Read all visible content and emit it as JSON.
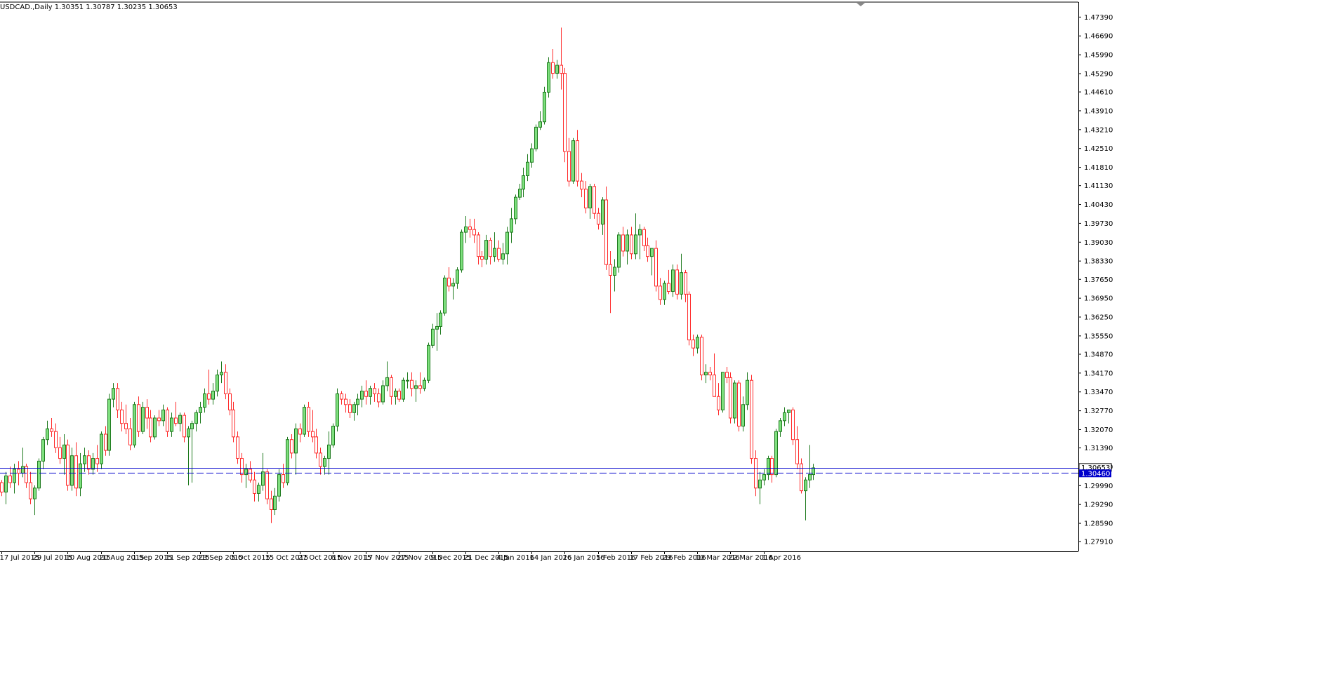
{
  "title": "USDCAD.,Daily  1.30351 1.30787 1.30235 1.30653",
  "colors": {
    "bull_body": "#7ee07e",
    "bull_border": "#1e7a1e",
    "bear_body": "#ffffff",
    "bear_border": "#ff2a2a",
    "bid_line": "#0000cc",
    "ask_line": "#0000cc",
    "frame": "#000000",
    "bid_tag_bg": "#0000cc",
    "bid_tag_text": "#ffffff",
    "last_tag_bg": "#ffffff",
    "last_tag_text": "#000000"
  },
  "price_tags": {
    "last": "1.30653",
    "bid": "1.30460"
  },
  "chart_data": {
    "type": "candlestick",
    "symbol": "USDCAD.",
    "timeframe": "Daily",
    "ylim": [
      1.2755,
      1.4792
    ],
    "y_ticks": [
      "1.47390",
      "1.46690",
      "1.45990",
      "1.45290",
      "1.44610",
      "1.43910",
      "1.43210",
      "1.42510",
      "1.41810",
      "1.41130",
      "1.40430",
      "1.39730",
      "1.39030",
      "1.38330",
      "1.37650",
      "1.36950",
      "1.36250",
      "1.35550",
      "1.34870",
      "1.34170",
      "1.33470",
      "1.32770",
      "1.32070",
      "1.31390",
      "1.30690",
      "1.29990",
      "1.29290",
      "1.28590",
      "1.27910"
    ],
    "x_ticks": [
      {
        "label": "17 Jul 2015",
        "index": 0
      },
      {
        "label": "29 Jul 2015",
        "index": 8
      },
      {
        "label": "10 Aug 2015",
        "index": 16
      },
      {
        "label": "20 Aug 2015",
        "index": 24
      },
      {
        "label": "1 Sep 2015",
        "index": 32
      },
      {
        "label": "11 Sep 2015",
        "index": 40
      },
      {
        "label": "23 Sep 2015",
        "index": 48
      },
      {
        "label": "5 Oct 2015",
        "index": 56
      },
      {
        "label": "15 Oct 2015",
        "index": 64
      },
      {
        "label": "27 Oct 2015",
        "index": 72
      },
      {
        "label": "6 Nov 2015",
        "index": 80
      },
      {
        "label": "17 Nov 2015",
        "index": 88
      },
      {
        "label": "27 Nov 2015",
        "index": 96
      },
      {
        "label": "9 Dec 2015",
        "index": 104
      },
      {
        "label": "21 Dec 2015",
        "index": 112
      },
      {
        "label": "4 Jan 2016",
        "index": 120
      },
      {
        "label": "14 Jan 2016",
        "index": 128
      },
      {
        "label": "26 Jan 2016",
        "index": 136
      },
      {
        "label": "5 Feb 2016",
        "index": 144
      },
      {
        "label": "17 Feb 2016",
        "index": 152
      },
      {
        "label": "29 Feb 2016",
        "index": 160
      },
      {
        "label": "10 Mar 2016",
        "index": 168
      },
      {
        "label": "22 Mar 2016",
        "index": 176
      },
      {
        "label": "1 Apr 2016",
        "index": 184
      }
    ],
    "horizontal_lines": [
      {
        "name": "ask-line",
        "value": 1.30653,
        "style": "solid"
      },
      {
        "name": "bid-line",
        "value": 1.3046,
        "style": "dashed"
      }
    ],
    "candles": [
      [
        1.301,
        1.302,
        1.296,
        1.2975
      ],
      [
        1.2975,
        1.305,
        1.293,
        1.3035
      ],
      [
        1.3035,
        1.307,
        1.299,
        1.301
      ],
      [
        1.301,
        1.308,
        1.297,
        1.306
      ],
      [
        1.306,
        1.309,
        1.3,
        1.3045
      ],
      [
        1.3045,
        1.314,
        1.303,
        1.307
      ],
      [
        1.307,
        1.308,
        1.299,
        1.301
      ],
      [
        1.301,
        1.305,
        1.293,
        1.295
      ],
      [
        1.295,
        1.3,
        1.289,
        1.299
      ],
      [
        1.299,
        1.31,
        1.298,
        1.309
      ],
      [
        1.309,
        1.318,
        1.306,
        1.317
      ],
      [
        1.317,
        1.324,
        1.315,
        1.321
      ],
      [
        1.321,
        1.325,
        1.318,
        1.32
      ],
      [
        1.32,
        1.323,
        1.312,
        1.314
      ],
      [
        1.314,
        1.318,
        1.308,
        1.31
      ],
      [
        1.31,
        1.319,
        1.304,
        1.315
      ],
      [
        1.315,
        1.317,
        1.298,
        1.3
      ],
      [
        1.3,
        1.314,
        1.298,
        1.311
      ],
      [
        1.311,
        1.316,
        1.296,
        1.299
      ],
      [
        1.299,
        1.312,
        1.296,
        1.308
      ],
      [
        1.308,
        1.314,
        1.305,
        1.311
      ],
      [
        1.311,
        1.313,
        1.304,
        1.306
      ],
      [
        1.306,
        1.312,
        1.304,
        1.31
      ],
      [
        1.31,
        1.315,
        1.305,
        1.308
      ],
      [
        1.308,
        1.32,
        1.306,
        1.319
      ],
      [
        1.319,
        1.322,
        1.311,
        1.313
      ],
      [
        1.313,
        1.334,
        1.311,
        1.332
      ],
      [
        1.332,
        1.338,
        1.329,
        1.336
      ],
      [
        1.336,
        1.338,
        1.325,
        1.328
      ],
      [
        1.328,
        1.331,
        1.32,
        1.323
      ],
      [
        1.323,
        1.33,
        1.319,
        1.321
      ],
      [
        1.321,
        1.325,
        1.313,
        1.315
      ],
      [
        1.315,
        1.331,
        1.314,
        1.33
      ],
      [
        1.33,
        1.333,
        1.318,
        1.32
      ],
      [
        1.32,
        1.331,
        1.319,
        1.329
      ],
      [
        1.329,
        1.332,
        1.321,
        1.325
      ],
      [
        1.325,
        1.328,
        1.316,
        1.318
      ],
      [
        1.318,
        1.326,
        1.317,
        1.325
      ],
      [
        1.325,
        1.328,
        1.322,
        1.324
      ],
      [
        1.324,
        1.33,
        1.322,
        1.328
      ],
      [
        1.328,
        1.329,
        1.318,
        1.32
      ],
      [
        1.32,
        1.327,
        1.318,
        1.325
      ],
      [
        1.325,
        1.331,
        1.322,
        1.323
      ],
      [
        1.323,
        1.327,
        1.32,
        1.326
      ],
      [
        1.326,
        1.327,
        1.316,
        1.318
      ],
      [
        1.318,
        1.322,
        1.3,
        1.321
      ],
      [
        1.321,
        1.324,
        1.301,
        1.323
      ],
      [
        1.323,
        1.328,
        1.32,
        1.327
      ],
      [
        1.327,
        1.331,
        1.323,
        1.329
      ],
      [
        1.329,
        1.336,
        1.327,
        1.334
      ],
      [
        1.334,
        1.343,
        1.33,
        1.332
      ],
      [
        1.332,
        1.338,
        1.33,
        1.335
      ],
      [
        1.335,
        1.343,
        1.333,
        1.341
      ],
      [
        1.341,
        1.346,
        1.338,
        1.342
      ],
      [
        1.342,
        1.345,
        1.332,
        1.334
      ],
      [
        1.334,
        1.336,
        1.326,
        1.328
      ],
      [
        1.328,
        1.331,
        1.316,
        1.318
      ],
      [
        1.318,
        1.32,
        1.308,
        1.31
      ],
      [
        1.31,
        1.312,
        1.301,
        1.304
      ],
      [
        1.304,
        1.308,
        1.299,
        1.306
      ],
      [
        1.306,
        1.309,
        1.301,
        1.302
      ],
      [
        1.302,
        1.305,
        1.294,
        1.297
      ],
      [
        1.297,
        1.301,
        1.294,
        1.3
      ],
      [
        1.3,
        1.312,
        1.298,
        1.305
      ],
      [
        1.305,
        1.306,
        1.293,
        1.295
      ],
      [
        1.295,
        1.298,
        1.286,
        1.291
      ],
      [
        1.291,
        1.299,
        1.289,
        1.296
      ],
      [
        1.296,
        1.306,
        1.294,
        1.304
      ],
      [
        1.304,
        1.308,
        1.299,
        1.301
      ],
      [
        1.301,
        1.318,
        1.3,
        1.317
      ],
      [
        1.317,
        1.319,
        1.31,
        1.312
      ],
      [
        1.312,
        1.323,
        1.304,
        1.321
      ],
      [
        1.321,
        1.323,
        1.316,
        1.319
      ],
      [
        1.319,
        1.33,
        1.318,
        1.329
      ],
      [
        1.329,
        1.331,
        1.318,
        1.32
      ],
      [
        1.32,
        1.328,
        1.316,
        1.318
      ],
      [
        1.318,
        1.321,
        1.31,
        1.312
      ],
      [
        1.312,
        1.314,
        1.304,
        1.307
      ],
      [
        1.307,
        1.311,
        1.304,
        1.31
      ],
      [
        1.31,
        1.32,
        1.304,
        1.315
      ],
      [
        1.315,
        1.323,
        1.314,
        1.322
      ],
      [
        1.322,
        1.336,
        1.32,
        1.334
      ],
      [
        1.334,
        1.335,
        1.33,
        1.332
      ],
      [
        1.332,
        1.334,
        1.327,
        1.33
      ],
      [
        1.33,
        1.332,
        1.325,
        1.327
      ],
      [
        1.327,
        1.331,
        1.324,
        1.33
      ],
      [
        1.33,
        1.334,
        1.326,
        1.332
      ],
      [
        1.332,
        1.337,
        1.329,
        1.335
      ],
      [
        1.335,
        1.339,
        1.33,
        1.333
      ],
      [
        1.333,
        1.337,
        1.33,
        1.336
      ],
      [
        1.336,
        1.338,
        1.331,
        1.334
      ],
      [
        1.334,
        1.336,
        1.329,
        1.331
      ],
      [
        1.331,
        1.339,
        1.33,
        1.337
      ],
      [
        1.337,
        1.346,
        1.335,
        1.34
      ],
      [
        1.34,
        1.341,
        1.33,
        1.333
      ],
      [
        1.333,
        1.336,
        1.33,
        1.335
      ],
      [
        1.335,
        1.336,
        1.331,
        1.332
      ],
      [
        1.332,
        1.34,
        1.331,
        1.339
      ],
      [
        1.339,
        1.342,
        1.336,
        1.339
      ],
      [
        1.339,
        1.342,
        1.333,
        1.336
      ],
      [
        1.336,
        1.339,
        1.331,
        1.337
      ],
      [
        1.337,
        1.342,
        1.334,
        1.336
      ],
      [
        1.336,
        1.34,
        1.335,
        1.339
      ],
      [
        1.339,
        1.353,
        1.338,
        1.352
      ],
      [
        1.352,
        1.36,
        1.351,
        1.358
      ],
      [
        1.358,
        1.364,
        1.35,
        1.359
      ],
      [
        1.359,
        1.365,
        1.356,
        1.364
      ],
      [
        1.364,
        1.378,
        1.363,
        1.377
      ],
      [
        1.377,
        1.381,
        1.372,
        1.374
      ],
      [
        1.374,
        1.377,
        1.369,
        1.375
      ],
      [
        1.375,
        1.381,
        1.373,
        1.38
      ],
      [
        1.38,
        1.395,
        1.379,
        1.394
      ],
      [
        1.394,
        1.4,
        1.39,
        1.396
      ],
      [
        1.396,
        1.399,
        1.392,
        1.395
      ],
      [
        1.395,
        1.399,
        1.39,
        1.393
      ],
      [
        1.393,
        1.394,
        1.382,
        1.385
      ],
      [
        1.385,
        1.387,
        1.381,
        1.384
      ],
      [
        1.384,
        1.393,
        1.382,
        1.391
      ],
      [
        1.391,
        1.392,
        1.382,
        1.385
      ],
      [
        1.385,
        1.394,
        1.383,
        1.388
      ],
      [
        1.388,
        1.391,
        1.383,
        1.384
      ],
      [
        1.384,
        1.39,
        1.382,
        1.386
      ],
      [
        1.386,
        1.396,
        1.382,
        1.394
      ],
      [
        1.394,
        1.403,
        1.39,
        1.399
      ],
      [
        1.399,
        1.408,
        1.397,
        1.407
      ],
      [
        1.407,
        1.412,
        1.406,
        1.41
      ],
      [
        1.41,
        1.418,
        1.407,
        1.415
      ],
      [
        1.415,
        1.423,
        1.413,
        1.42
      ],
      [
        1.42,
        1.427,
        1.418,
        1.425
      ],
      [
        1.425,
        1.434,
        1.424,
        1.433
      ],
      [
        1.433,
        1.439,
        1.432,
        1.435
      ],
      [
        1.435,
        1.448,
        1.434,
        1.446
      ],
      [
        1.446,
        1.459,
        1.444,
        1.457
      ],
      [
        1.457,
        1.462,
        1.451,
        1.453
      ],
      [
        1.453,
        1.458,
        1.451,
        1.456
      ],
      [
        1.456,
        1.47,
        1.447,
        1.453
      ],
      [
        1.453,
        1.455,
        1.42,
        1.424
      ],
      [
        1.424,
        1.429,
        1.411,
        1.413
      ],
      [
        1.413,
        1.429,
        1.412,
        1.428
      ],
      [
        1.428,
        1.432,
        1.411,
        1.413
      ],
      [
        1.413,
        1.416,
        1.407,
        1.41
      ],
      [
        1.41,
        1.413,
        1.401,
        1.403
      ],
      [
        1.403,
        1.412,
        1.399,
        1.411
      ],
      [
        1.411,
        1.412,
        1.399,
        1.401
      ],
      [
        1.401,
        1.403,
        1.395,
        1.397
      ],
      [
        1.397,
        1.407,
        1.393,
        1.406
      ],
      [
        1.406,
        1.411,
        1.38,
        1.382
      ],
      [
        1.382,
        1.387,
        1.364,
        1.378
      ],
      [
        1.378,
        1.384,
        1.372,
        1.381
      ],
      [
        1.381,
        1.394,
        1.379,
        1.393
      ],
      [
        1.393,
        1.396,
        1.385,
        1.387
      ],
      [
        1.387,
        1.395,
        1.382,
        1.393
      ],
      [
        1.393,
        1.396,
        1.384,
        1.386
      ],
      [
        1.386,
        1.401,
        1.384,
        1.393
      ],
      [
        1.393,
        1.397,
        1.384,
        1.395
      ],
      [
        1.395,
        1.396,
        1.387,
        1.389
      ],
      [
        1.389,
        1.392,
        1.383,
        1.385
      ],
      [
        1.385,
        1.388,
        1.378,
        1.388
      ],
      [
        1.388,
        1.391,
        1.372,
        1.374
      ],
      [
        1.374,
        1.377,
        1.367,
        1.369
      ],
      [
        1.369,
        1.376,
        1.367,
        1.375
      ],
      [
        1.375,
        1.38,
        1.371,
        1.372
      ],
      [
        1.372,
        1.382,
        1.37,
        1.38
      ],
      [
        1.38,
        1.382,
        1.369,
        1.371
      ],
      [
        1.371,
        1.386,
        1.369,
        1.379
      ],
      [
        1.379,
        1.38,
        1.368,
        1.371
      ],
      [
        1.371,
        1.372,
        1.352,
        1.354
      ],
      [
        1.354,
        1.356,
        1.348,
        1.351
      ],
      [
        1.351,
        1.356,
        1.349,
        1.355
      ],
      [
        1.355,
        1.356,
        1.339,
        1.341
      ],
      [
        1.341,
        1.345,
        1.338,
        1.342
      ],
      [
        1.342,
        1.344,
        1.339,
        1.341
      ],
      [
        1.341,
        1.349,
        1.34,
        1.333
      ],
      [
        1.333,
        1.338,
        1.326,
        1.328
      ],
      [
        1.328,
        1.339,
        1.327,
        1.342
      ],
      [
        1.342,
        1.344,
        1.338,
        1.34
      ],
      [
        1.34,
        1.342,
        1.323,
        1.325
      ],
      [
        1.325,
        1.339,
        1.323,
        1.338
      ],
      [
        1.338,
        1.339,
        1.32,
        1.322
      ],
      [
        1.322,
        1.333,
        1.32,
        1.33
      ],
      [
        1.33,
        1.342,
        1.328,
        1.339
      ],
      [
        1.339,
        1.341,
        1.308,
        1.31
      ],
      [
        1.31,
        1.313,
        1.296,
        1.299
      ],
      [
        1.299,
        1.305,
        1.293,
        1.302
      ],
      [
        1.302,
        1.306,
        1.3,
        1.304
      ],
      [
        1.304,
        1.311,
        1.302,
        1.31
      ],
      [
        1.31,
        1.311,
        1.301,
        1.304
      ],
      [
        1.304,
        1.321,
        1.303,
        1.32
      ],
      [
        1.32,
        1.325,
        1.318,
        1.324
      ],
      [
        1.324,
        1.329,
        1.322,
        1.327
      ],
      [
        1.327,
        1.328,
        1.323,
        1.328
      ],
      [
        1.328,
        1.329,
        1.315,
        1.317
      ],
      [
        1.317,
        1.322,
        1.306,
        1.308
      ],
      [
        1.308,
        1.31,
        1.297,
        1.298
      ],
      [
        1.298,
        1.303,
        1.287,
        1.302
      ],
      [
        1.302,
        1.315,
        1.299,
        1.304
      ],
      [
        1.304,
        1.308,
        1.302,
        1.3065
      ]
    ]
  }
}
